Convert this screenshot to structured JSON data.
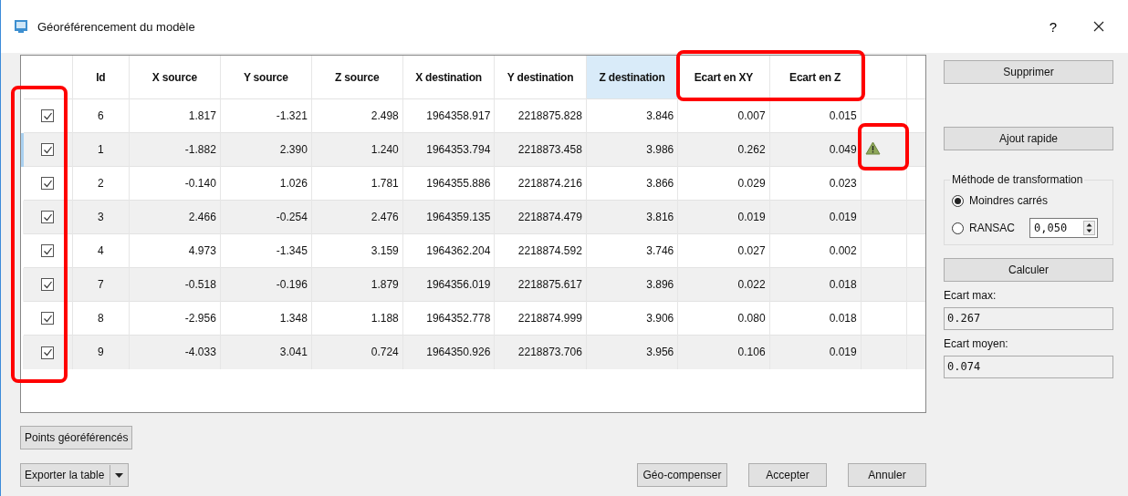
{
  "window": {
    "title": "Géoréférencement du modèle",
    "help": "?"
  },
  "table": {
    "columns": [
      {
        "label": "Id",
        "highlighted": false
      },
      {
        "label": "X source",
        "highlighted": false
      },
      {
        "label": "Y source",
        "highlighted": false
      },
      {
        "label": "Z source",
        "highlighted": false
      },
      {
        "label": "X destination",
        "highlighted": false
      },
      {
        "label": "Y destination",
        "highlighted": false
      },
      {
        "label": "Z destination",
        "highlighted": true
      },
      {
        "label": "Ecart en XY",
        "highlighted": false
      },
      {
        "label": "Ecart en Z",
        "highlighted": false
      }
    ],
    "rows": [
      {
        "checked": true,
        "current": false,
        "warning": false,
        "cells": [
          "6",
          "1.817",
          "-1.321",
          "2.498",
          "1964358.917",
          "2218875.828",
          "3.846",
          "0.007",
          "0.015"
        ]
      },
      {
        "checked": true,
        "current": true,
        "warning": true,
        "cells": [
          "1",
          "-1.882",
          "2.390",
          "1.240",
          "1964353.794",
          "2218873.458",
          "3.986",
          "0.262",
          "0.049"
        ]
      },
      {
        "checked": true,
        "current": false,
        "warning": false,
        "cells": [
          "2",
          "-0.140",
          "1.026",
          "1.781",
          "1964355.886",
          "2218874.216",
          "3.866",
          "0.029",
          "0.023"
        ]
      },
      {
        "checked": true,
        "current": false,
        "warning": false,
        "cells": [
          "3",
          "2.466",
          "-0.254",
          "2.476",
          "1964359.135",
          "2218874.479",
          "3.816",
          "0.019",
          "0.019"
        ]
      },
      {
        "checked": true,
        "current": false,
        "warning": false,
        "cells": [
          "4",
          "4.973",
          "-1.345",
          "3.159",
          "1964362.204",
          "2218874.592",
          "3.746",
          "0.027",
          "0.002"
        ]
      },
      {
        "checked": true,
        "current": false,
        "warning": false,
        "cells": [
          "7",
          "-0.518",
          "-0.196",
          "1.879",
          "1964356.019",
          "2218875.617",
          "3.896",
          "0.022",
          "0.018"
        ]
      },
      {
        "checked": true,
        "current": false,
        "warning": false,
        "cells": [
          "8",
          "-2.956",
          "1.348",
          "1.188",
          "1964352.778",
          "2218874.999",
          "3.906",
          "0.080",
          "0.018"
        ]
      },
      {
        "checked": true,
        "current": false,
        "warning": false,
        "cells": [
          "9",
          "-4.033",
          "3.041",
          "0.724",
          "1964350.926",
          "2218873.706",
          "3.956",
          "0.106",
          "0.019"
        ]
      }
    ]
  },
  "side": {
    "delete_button": "Supprimer",
    "quick_add_button": "Ajout rapide",
    "method": {
      "title": "Méthode de transformation",
      "options": [
        {
          "label": "Moindres carrés",
          "selected": true
        },
        {
          "label": "RANSAC",
          "selected": false
        }
      ],
      "ransac_value": "0,050"
    },
    "compute_button": "Calculer",
    "max_label": "Ecart max:",
    "max_value": "0.267",
    "mean_label": "Ecart moyen:",
    "mean_value": "0.074"
  },
  "bottom": {
    "points_button": "Points géoréférencés",
    "export_button": "Exporter la table",
    "buttons": [
      "Géo-compenser",
      "Accepter",
      "Annuler"
    ]
  },
  "annotations": [
    {
      "kind": "checkbox-column"
    },
    {
      "kind": "deviation-headers"
    },
    {
      "kind": "warning-cell"
    }
  ]
}
